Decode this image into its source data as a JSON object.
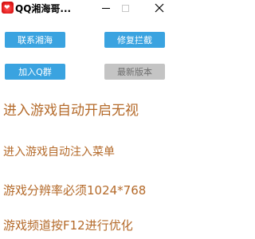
{
  "window": {
    "title": "QQ湘海哥...",
    "icons": {
      "app": "heart-logo-icon",
      "minimize": "minimize-icon",
      "maximize": "maximize-icon",
      "close": "close-icon"
    }
  },
  "buttons": {
    "contact": "联系湘海",
    "repair": "修复拦截",
    "join_group": "加入Q群",
    "latest_version": "最新版本"
  },
  "colors": {
    "button_blue": "#3aa3e0",
    "button_gray": "#c4c4c4",
    "text_orange": "#b46a2a"
  },
  "notes": [
    "进入游戏自动开启无视",
    "进入游戏自动注入菜单",
    "游戏分辨率必须1024*768",
    "游戏频道按F12进行优化"
  ]
}
